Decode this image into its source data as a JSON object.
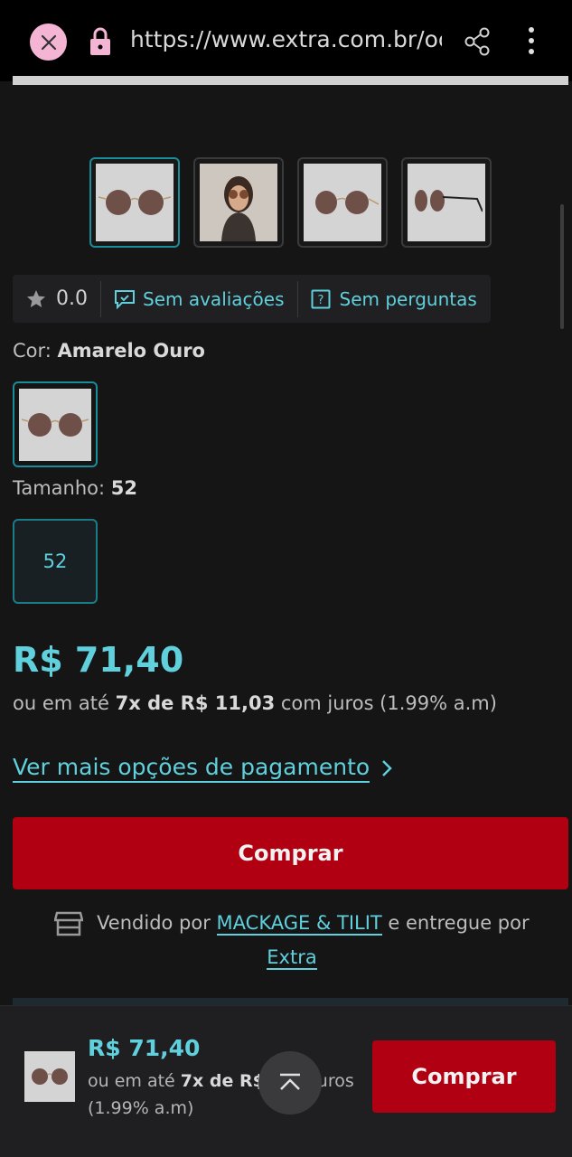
{
  "browser": {
    "url": "https://www.extra.com.br/oc",
    "icons": [
      "close-icon",
      "lock-icon",
      "share-icon",
      "more-vert-icon"
    ]
  },
  "gallery": {
    "thumbnails": [
      "sunglasses-front",
      "model-photo",
      "sunglasses-angle",
      "sunglasses-side"
    ]
  },
  "rating": {
    "score": "0.0",
    "reviews_label": "Sem avaliações",
    "questions_label": "Sem perguntas"
  },
  "color": {
    "label": "Cor:",
    "value": "Amarelo Ouro"
  },
  "size": {
    "label": "Tamanho:",
    "value": "52",
    "option": "52"
  },
  "price": {
    "value": "R$ 71,40",
    "installment_prefix": "ou em até",
    "installment_value": "7x de R$ 11,03",
    "installment_suffix": "com juros (1.99% a.m)"
  },
  "payment": {
    "more_options_label": "Ver mais opções de pagamento"
  },
  "buy_button": {
    "label": "Comprar"
  },
  "seller": {
    "sold_by": "Vendido por",
    "seller_name": "MACKAGE & TILIT",
    "delivered_by": "e entregue por",
    "carrier": "Extra"
  },
  "bottom_bar": {
    "price": "R$ 71,40",
    "installment_prefix": "ou em até",
    "installment_value": "7x de R$",
    "installment_suffix": "com juros (1.99% a.m)",
    "buy_label": "Comprar"
  },
  "colors": {
    "accent": "#5fd0dc",
    "buy": "#b00012",
    "background": "#151516"
  }
}
